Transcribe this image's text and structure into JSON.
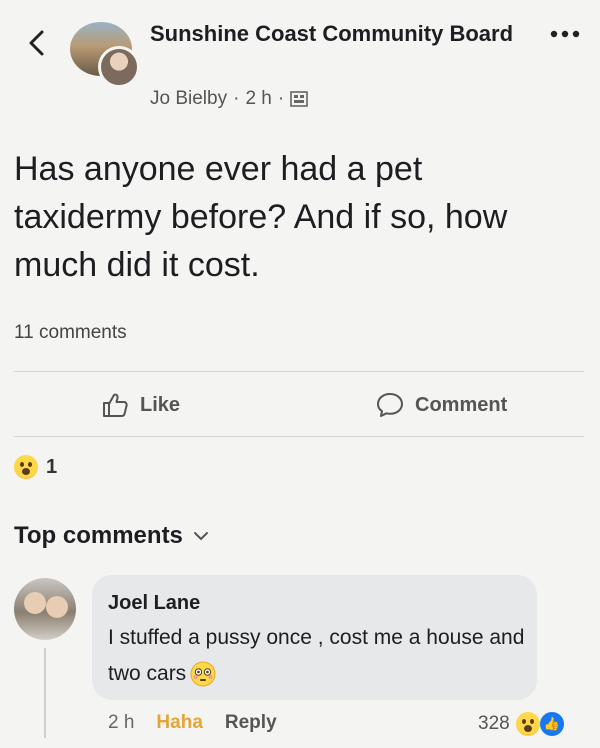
{
  "header": {
    "group_name": "Sunshine Coast Community Board",
    "author": "Jo Bielby",
    "time": "2 h",
    "separator": "·"
  },
  "post": {
    "text": "Has anyone ever had a pet taxidermy before? And if so, how much did it cost.",
    "comments_count": "11 comments"
  },
  "actions": {
    "like_label": "Like",
    "comment_label": "Comment"
  },
  "reactions": {
    "count": "1",
    "type": "wow"
  },
  "top_comments": {
    "label": "Top comments"
  },
  "comment": {
    "name": "Joel Lane",
    "text": "I stuffed a pussy once , cost me a house and two cars",
    "time": "2 h",
    "haha_label": "Haha",
    "reply_label": "Reply",
    "reaction_count": "328"
  },
  "colors": {
    "background": "#f4f4f2",
    "bubble": "#e7e8ea",
    "haha": "#e3a43a",
    "like_blue": "#1877f2"
  },
  "icons": {
    "back": "chevron-left-icon",
    "more": "more-icon",
    "privacy": "public-group-icon",
    "like": "thumbs-up-icon",
    "comment": "comment-icon",
    "reaction": "wow-emoji-icon",
    "dropdown": "chevron-down-icon"
  }
}
